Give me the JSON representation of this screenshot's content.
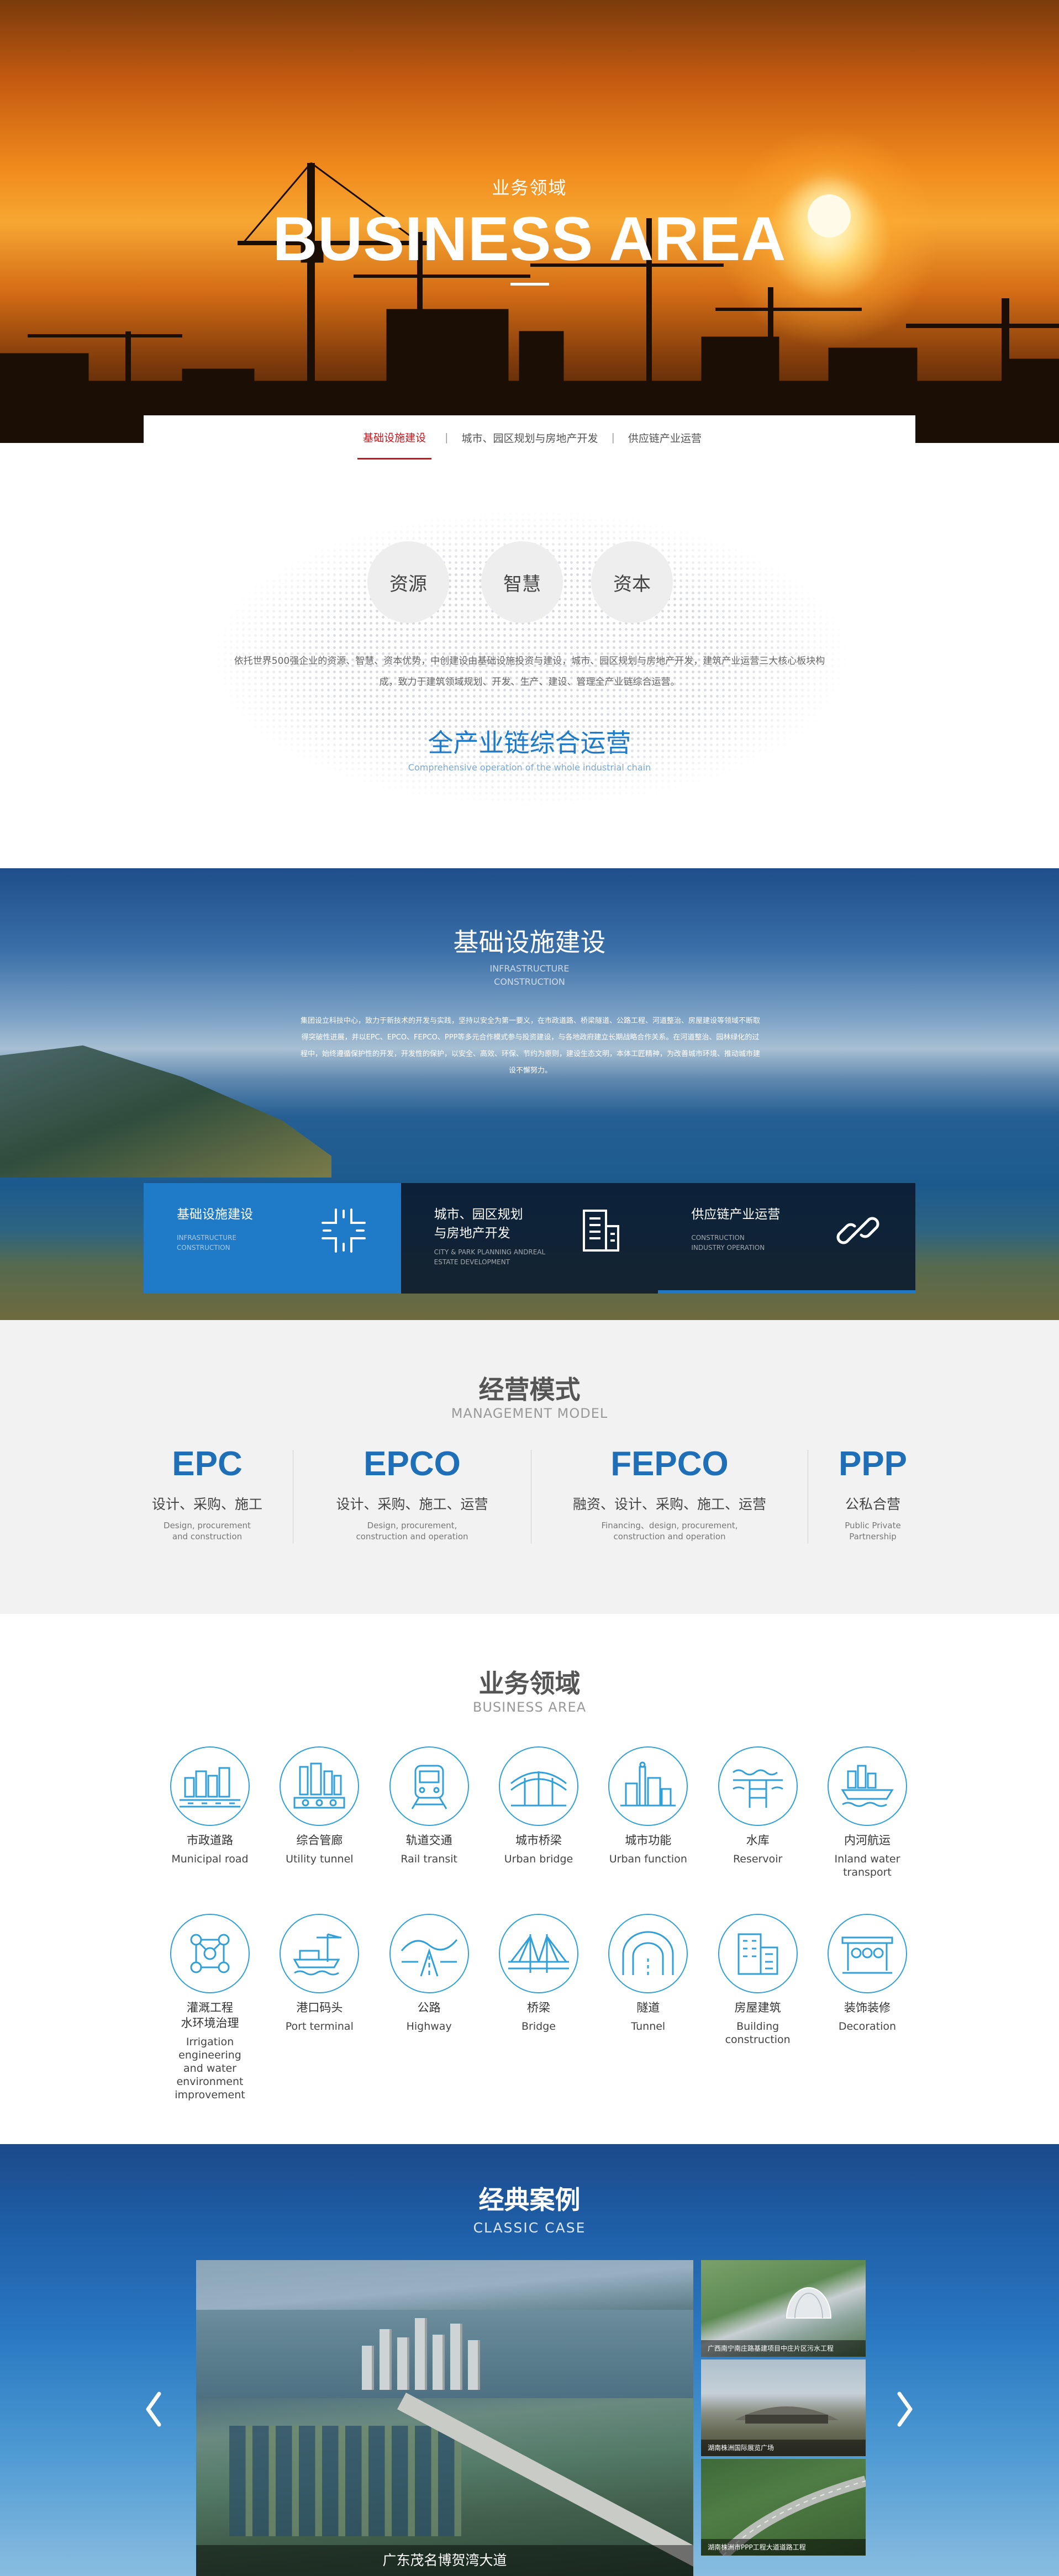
{
  "hero": {
    "title_cn": "业务领域",
    "title_en": "BUSINESS AREA"
  },
  "subnav": {
    "items": [
      {
        "label": "基础设施建设",
        "active": true
      },
      {
        "label": "城市、园区规划与房地产开发",
        "active": false
      },
      {
        "label": "供应链产业运营",
        "active": false
      }
    ],
    "separator": "|"
  },
  "intro": {
    "circles": [
      "资源",
      "智慧",
      "资本"
    ],
    "description": "依托世界500强企业的资源、智慧、资本优势，中创建设由基础设施投资与建设，城市、园区规划与房地产开发，建筑产业运营三大核心板块构成，致力于建筑领域规划、开发、生产、建设、管理全产业链综合运营。",
    "title": "全产业链综合运营",
    "subtitle": "Comprehensive operation of the whole industrial chain"
  },
  "infrastructure": {
    "title": "基础设施建设",
    "title_en_1": "INFRASTRUCTURE",
    "title_en_2": "CONSTRUCTION",
    "paragraph": "集团设立科技中心，致力于新技术的开发与实践，坚持以安全为第一要义，在市政道路、桥梁隧道、公路工程、河道整治、房屋建设等领域不断取得突破性进展，并以EPC、EPCO、FEPCO、PPP等多元合作模式参与投资建设，与各地政府建立长期战略合作关系。在河道整治、园林绿化的过程中，始终遵循保护性的开发，开发性的保护，以安全、高效、环保、节约为原则，建设生态文明，本体工匠精神，为改善城市环境、推动城市建设不懈努力。",
    "cards": [
      {
        "title": "基础设施建设",
        "en_1": "INFRASTRUCTURE",
        "en_2": "CONSTRUCTION",
        "icon": "road-junction-icon",
        "active": true
      },
      {
        "title_1": "城市、园区规划",
        "title_2": "与房地产开发",
        "en_1": "CITY & PARK PLANNING ANDREAL",
        "en_2": "ESTATE DEVELOPMENT",
        "icon": "building-icon",
        "active": false
      },
      {
        "title": "供应链产业运营",
        "en_1": "CONSTRUCTION",
        "en_2": "INDUSTRY OPERATION",
        "icon": "chain-link-icon",
        "active": false
      }
    ],
    "colors": {
      "active": "#1f7ac8",
      "card_bg": "#0a192d"
    }
  },
  "management": {
    "title": "经营模式",
    "subtitle": "MANAGEMENT MODEL",
    "models": [
      {
        "code": "EPC",
        "zh": "设计、采购、施工",
        "en_1": "Design, procurement",
        "en_2": "and construction"
      },
      {
        "code": "EPCO",
        "zh": "设计、采购、施工、运营",
        "en_1": "Design, procurement,",
        "en_2": "construction and operation"
      },
      {
        "code": "FEPCO",
        "zh": "融资、设计、采购、施工、运营",
        "en_1": "Financing、design, procurement,",
        "en_2": "construction and operation"
      },
      {
        "code": "PPP",
        "zh": "公私合营",
        "en_1": "Public Private",
        "en_2": "Partnership"
      }
    ]
  },
  "business": {
    "title": "业务领域",
    "subtitle": "BUSINESS AREA",
    "row1": [
      {
        "zh": "市政道路",
        "en_1": "Municipal road",
        "icon": "municipal-road-icon"
      },
      {
        "zh": "综合管廊",
        "en_1": "Utility tunnel",
        "icon": "utility-tunnel-icon"
      },
      {
        "zh": "轨道交通",
        "en_1": "Rail transit",
        "icon": "rail-transit-icon"
      },
      {
        "zh": "城市桥梁",
        "en_1": "Urban bridge",
        "icon": "urban-bridge-icon"
      },
      {
        "zh": "城市功能",
        "en_1": "Urban function",
        "icon": "urban-function-icon"
      },
      {
        "zh": "水库",
        "en_1": "Reservoir",
        "icon": "reservoir-icon"
      },
      {
        "zh": "内河航运",
        "en_1": "Inland water",
        "en_2": "transport",
        "icon": "inland-water-transport-icon"
      }
    ],
    "row2": [
      {
        "zh_1": "灌溉工程",
        "zh_2": "水环境治理",
        "en_1": "Irrigation engineering",
        "en_2": "and water environment",
        "en_3": "improvement",
        "icon": "irrigation-icon"
      },
      {
        "zh_1": "港口码头",
        "en_1": "Port terminal",
        "icon": "port-terminal-icon"
      },
      {
        "zh_1": "公路",
        "en_1": "Highway",
        "icon": "highway-icon"
      },
      {
        "zh_1": "桥梁",
        "en_1": "Bridge",
        "icon": "bridge-icon"
      },
      {
        "zh_1": "隧道",
        "en_1": "Tunnel",
        "icon": "tunnel-icon"
      },
      {
        "zh_1": "房屋建筑",
        "en_1": "Building construction",
        "icon": "building-construction-icon"
      },
      {
        "zh_1": "装饰装修",
        "en_1": "Decoration",
        "icon": "decoration-icon"
      }
    ],
    "icon_color": "#32a0d8"
  },
  "cases": {
    "title": "经典案例",
    "subtitle": "CLASSIC CASE",
    "main_caption": "广东茂名博贺湾大道",
    "thumbs": [
      "广西南宁南庄路基建项目中庄片区污水工程",
      "湖南株洲国际展览广场",
      "湖南株洲市PPP工程大道道路工程"
    ],
    "prev_icon": "chevron-left-icon",
    "next_icon": "chevron-right-icon"
  }
}
